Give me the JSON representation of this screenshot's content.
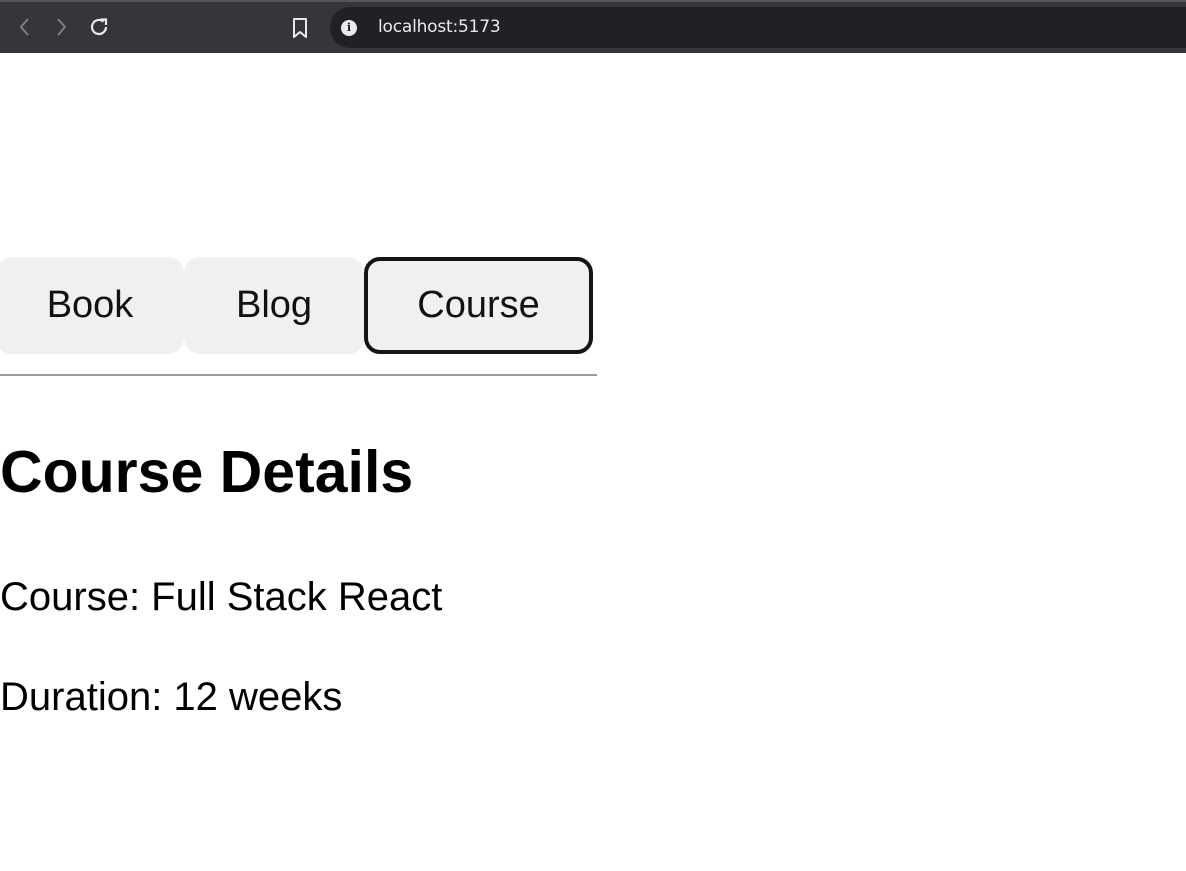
{
  "browser": {
    "url": "localhost:5173",
    "icons": {
      "back": "chevron-left-icon",
      "forward": "chevron-right-icon",
      "reload": "reload-icon",
      "bookmark": "bookmark-icon",
      "site_info": "info-icon"
    },
    "info_glyph": "i"
  },
  "tabs": [
    {
      "label": "Book",
      "active": false
    },
    {
      "label": "Blog",
      "active": false
    },
    {
      "label": "Course",
      "active": true
    }
  ],
  "content": {
    "title": "Course Details",
    "course_line": "Course: Full Stack React",
    "duration_line": "Duration: 12 weeks"
  },
  "colors": {
    "tab_background": "#f0f0f0",
    "active_tab_border": "#141414",
    "browser_chrome": "#35363a",
    "address_bar": "#202124"
  }
}
